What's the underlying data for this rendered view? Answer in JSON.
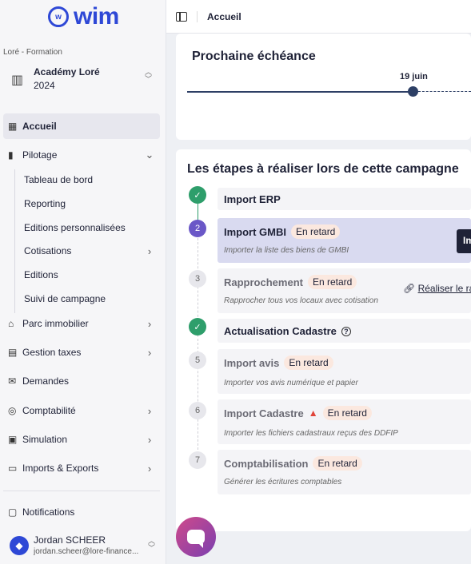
{
  "app": {
    "brand": "wim",
    "logo_mark": "w"
  },
  "org": {
    "caption": "Loré - Formation",
    "name": "Académy Loré",
    "year": "2024"
  },
  "nav": {
    "accueil": "Accueil",
    "pilotage": "Pilotage",
    "pilotage_items": [
      "Tableau de bord",
      "Reporting",
      "Editions personnalisées",
      "Cotisations",
      "Editions",
      "Suivi de campagne"
    ],
    "parc": "Parc immobilier",
    "taxes": "Gestion taxes",
    "demandes": "Demandes",
    "compta": "Comptabilité",
    "simulation": "Simulation",
    "imports": "Imports & Exports",
    "notifications": "Notifications"
  },
  "user": {
    "name": "Jordan SCHEER",
    "email": "jordan.scheer@lore-finance..."
  },
  "header": {
    "breadcrumb": "Accueil"
  },
  "deadline": {
    "title": "Prochaine échéance",
    "date": "19 juin"
  },
  "steps": {
    "title": "Les étapes à réaliser lors de cette campagne",
    "late_label": "En retard",
    "items": [
      {
        "num": "",
        "title": "Import ERP",
        "desc": "",
        "status": "done"
      },
      {
        "num": "2",
        "title": "Import GMBI",
        "desc": "Importer la liste des biens de GMBI",
        "status": "current",
        "action": "Im"
      },
      {
        "num": "3",
        "title": "Rapprochement",
        "desc": "Rapprocher tous vos locaux avec cotisation",
        "status": "todo",
        "link": "Réaliser le ra"
      },
      {
        "num": "",
        "title": "Actualisation Cadastre",
        "desc": "",
        "status": "done"
      },
      {
        "num": "5",
        "title": "Import avis",
        "desc": "Importer vos avis numérique et papier",
        "status": "todo"
      },
      {
        "num": "6",
        "title": "Import Cadastre",
        "desc": "Importer les fichiers cadastraux reçus des DDFIP",
        "status": "todo"
      },
      {
        "num": "7",
        "title": "Comptabilisation",
        "desc": "Générer les écritures comptables",
        "status": "todo"
      }
    ]
  }
}
